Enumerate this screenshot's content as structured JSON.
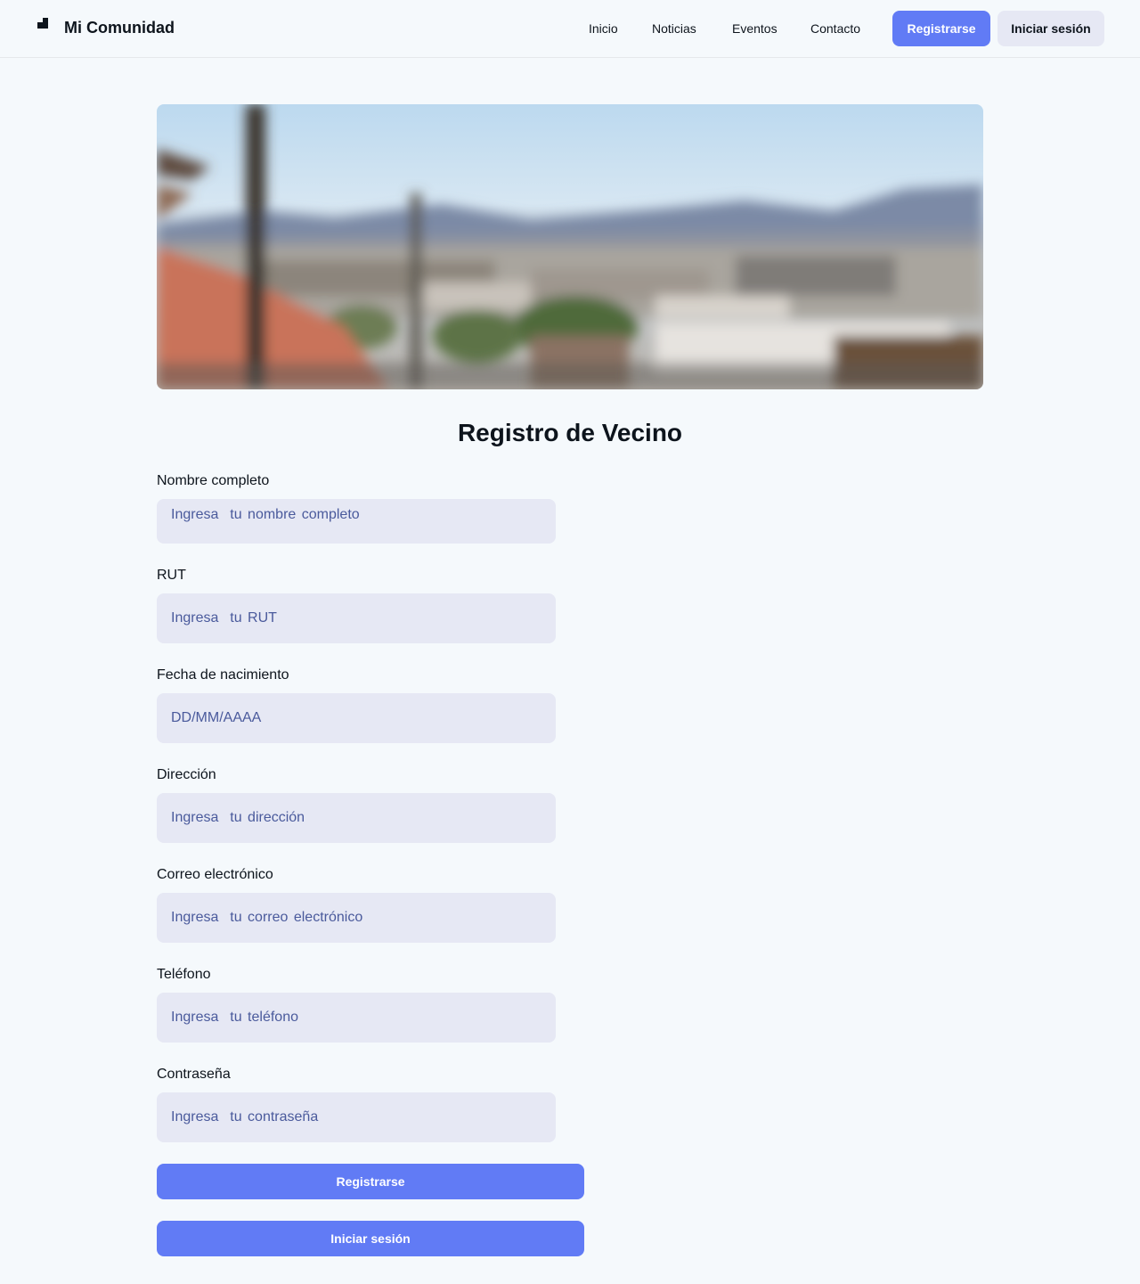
{
  "header": {
    "brand": "Mi Comunidad",
    "logo_icon": "community-logo-icon",
    "nav": {
      "inicio": "Inicio",
      "noticias": "Noticias",
      "eventos": "Eventos",
      "contacto": "Contacto"
    },
    "register_label": "Registrarse",
    "login_label": "Iniciar sesión"
  },
  "hero": {
    "image": "blurred-city-hillside-photo"
  },
  "form": {
    "title": "Registro de Vecino",
    "fields": {
      "nombre": {
        "label": "Nombre completo",
        "placeholder": "Ingresa  tu nombre completo",
        "value": ""
      },
      "rut": {
        "label": "RUT",
        "placeholder": "Ingresa  tu RUT",
        "value": ""
      },
      "fecha": {
        "label": "Fecha de nacimiento",
        "placeholder": "DD/MM/AAAA",
        "value": ""
      },
      "direccion": {
        "label": "Dirección",
        "placeholder": "Ingresa  tu dirección",
        "value": ""
      },
      "correo": {
        "label": "Correo electrónico",
        "placeholder": "Ingresa  tu correo electrónico",
        "value": ""
      },
      "telefono": {
        "label": "Teléfono",
        "placeholder": "Ingresa  tu teléfono",
        "value": ""
      },
      "contrasena": {
        "label": "Contraseña",
        "placeholder": "Ingresa  tu contraseña",
        "value": ""
      }
    },
    "register_button": "Registrarse",
    "login_button": "Iniciar sesión"
  },
  "colors": {
    "accent": "#617bf5",
    "input_bg": "#e6e8f4",
    "page_bg": "#f5f9fc",
    "placeholder": "#4a5a9c",
    "text": "#0d141c"
  }
}
